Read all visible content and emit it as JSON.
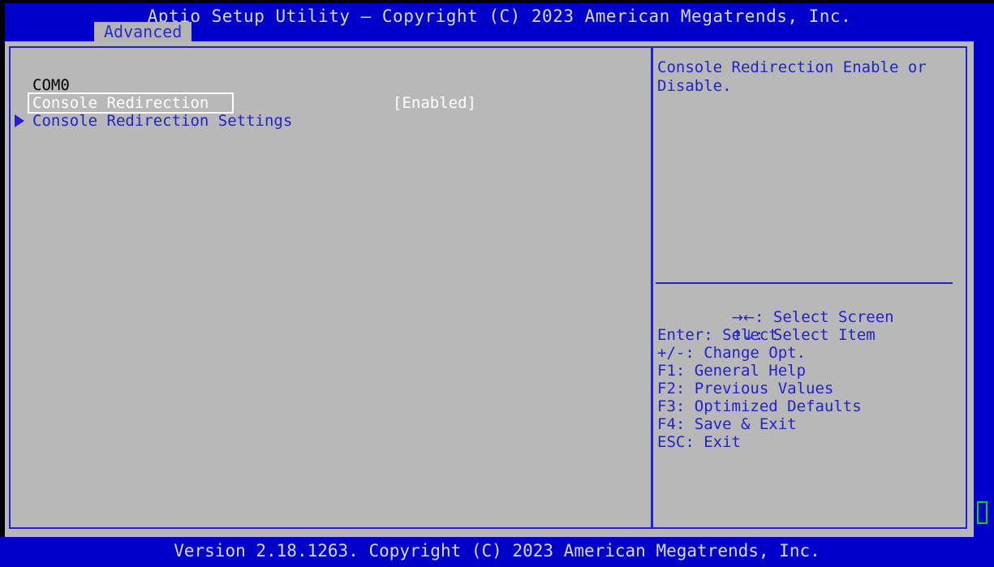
{
  "header": {
    "title": "Aptio Setup Utility – Copyright (C) 2023 American Megatrends, Inc.",
    "tabs": [
      {
        "label": "Advanced",
        "active": true
      }
    ]
  },
  "main": {
    "group_label": "COM0",
    "options": [
      {
        "label": "Console Redirection",
        "value": "[Enabled]",
        "selected": true,
        "type": "option"
      },
      {
        "label": "Console Redirection Settings",
        "value": "",
        "selected": false,
        "type": "submenu",
        "icon": "triangle-right-icon"
      }
    ]
  },
  "help": {
    "text": "Console Redirection Enable or Disable.",
    "keys": [
      {
        "glyph": "→←",
        "text": ": Select Screen"
      },
      {
        "glyph": "↑↓",
        "text": ": Select Item"
      },
      {
        "glyph": "",
        "text": "Enter: Select"
      },
      {
        "glyph": "",
        "text": "+/-: Change Opt."
      },
      {
        "glyph": "",
        "text": "F1: General Help"
      },
      {
        "glyph": "",
        "text": "F2: Previous Values"
      },
      {
        "glyph": "",
        "text": "F3: Optimized Defaults"
      },
      {
        "glyph": "",
        "text": "F4: Save & Exit"
      },
      {
        "glyph": "",
        "text": "ESC: Exit"
      }
    ]
  },
  "footer": {
    "text": "Version 2.18.1263. Copyright (C) 2023 American Megatrends, Inc."
  },
  "colors": {
    "background_blue": "#0000c8",
    "panel_gray": "#b8b8b8",
    "border_blue": "#2222cc",
    "text_light": "#d8d8d8",
    "highlight_white": "#ffffff",
    "scroll_green": "#00dd00",
    "text_black": "#000000"
  }
}
